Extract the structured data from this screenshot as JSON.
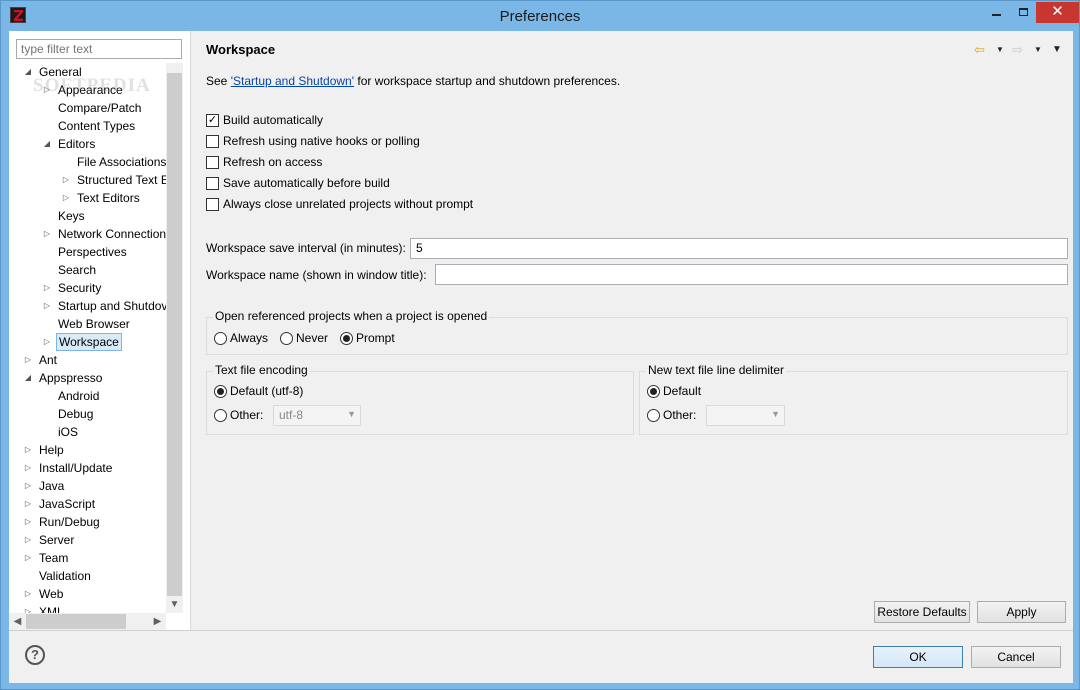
{
  "window": {
    "title": "Preferences"
  },
  "filter": {
    "placeholder": "type filter text"
  },
  "watermark": "SOFTPEDIA",
  "tree": [
    {
      "label": "General",
      "depth": 0,
      "arrow": "◢"
    },
    {
      "label": "Appearance",
      "depth": 1,
      "arrow": "▷"
    },
    {
      "label": "Compare/Patch",
      "depth": 1,
      "arrow": ""
    },
    {
      "label": "Content Types",
      "depth": 1,
      "arrow": ""
    },
    {
      "label": "Editors",
      "depth": 1,
      "arrow": "◢"
    },
    {
      "label": "File Associations",
      "depth": 2,
      "arrow": ""
    },
    {
      "label": "Structured Text E",
      "depth": 2,
      "arrow": "▷"
    },
    {
      "label": "Text Editors",
      "depth": 2,
      "arrow": "▷"
    },
    {
      "label": "Keys",
      "depth": 1,
      "arrow": ""
    },
    {
      "label": "Network Connection",
      "depth": 1,
      "arrow": "▷"
    },
    {
      "label": "Perspectives",
      "depth": 1,
      "arrow": ""
    },
    {
      "label": "Search",
      "depth": 1,
      "arrow": ""
    },
    {
      "label": "Security",
      "depth": 1,
      "arrow": "▷"
    },
    {
      "label": "Startup and Shutdov",
      "depth": 1,
      "arrow": "▷"
    },
    {
      "label": "Web Browser",
      "depth": 1,
      "arrow": ""
    },
    {
      "label": "Workspace",
      "depth": 1,
      "arrow": "▷",
      "selected": true
    },
    {
      "label": "Ant",
      "depth": 0,
      "arrow": "▷"
    },
    {
      "label": "Appspresso",
      "depth": 0,
      "arrow": "◢"
    },
    {
      "label": "Android",
      "depth": 1,
      "arrow": ""
    },
    {
      "label": "Debug",
      "depth": 1,
      "arrow": ""
    },
    {
      "label": "iOS",
      "depth": 1,
      "arrow": ""
    },
    {
      "label": "Help",
      "depth": 0,
      "arrow": "▷"
    },
    {
      "label": "Install/Update",
      "depth": 0,
      "arrow": "▷"
    },
    {
      "label": "Java",
      "depth": 0,
      "arrow": "▷"
    },
    {
      "label": "JavaScript",
      "depth": 0,
      "arrow": "▷"
    },
    {
      "label": "Run/Debug",
      "depth": 0,
      "arrow": "▷"
    },
    {
      "label": "Server",
      "depth": 0,
      "arrow": "▷"
    },
    {
      "label": "Team",
      "depth": 0,
      "arrow": "▷"
    },
    {
      "label": "Validation",
      "depth": 0,
      "arrow": ""
    },
    {
      "label": "Web",
      "depth": 0,
      "arrow": "▷"
    },
    {
      "label": "XML",
      "depth": 0,
      "arrow": "▷"
    }
  ],
  "page": {
    "title": "Workspace",
    "see_prefix": "See ",
    "see_link": "'Startup and Shutdown'",
    "see_suffix": " for workspace startup and shutdown preferences."
  },
  "checkboxes": [
    {
      "label": "Build automatically",
      "checked": true
    },
    {
      "label": "Refresh using native hooks or polling",
      "checked": false
    },
    {
      "label": "Refresh on access",
      "checked": false
    },
    {
      "label": "Save automatically before build",
      "checked": false
    },
    {
      "label": "Always close unrelated projects without prompt",
      "checked": false
    }
  ],
  "save_interval": {
    "label": "Workspace save interval (in minutes):",
    "value": "5"
  },
  "workspace_name": {
    "label": "Workspace name (shown in window title):",
    "value": ""
  },
  "open_projects": {
    "title": "Open referenced projects when a project is opened",
    "options": [
      "Always",
      "Never",
      "Prompt"
    ],
    "selected": "Prompt"
  },
  "encoding": {
    "title": "Text file encoding",
    "default_label": "Default (utf-8)",
    "other_label": "Other:",
    "other_value": "utf-8",
    "selected": "default"
  },
  "line_delimiter": {
    "title": "New text file line delimiter",
    "default_label": "Default",
    "other_label": "Other:",
    "other_value": "",
    "selected": "default"
  },
  "buttons": {
    "restore_defaults": "Restore Defaults",
    "apply": "Apply",
    "ok": "OK",
    "cancel": "Cancel"
  },
  "help_icon": "?"
}
